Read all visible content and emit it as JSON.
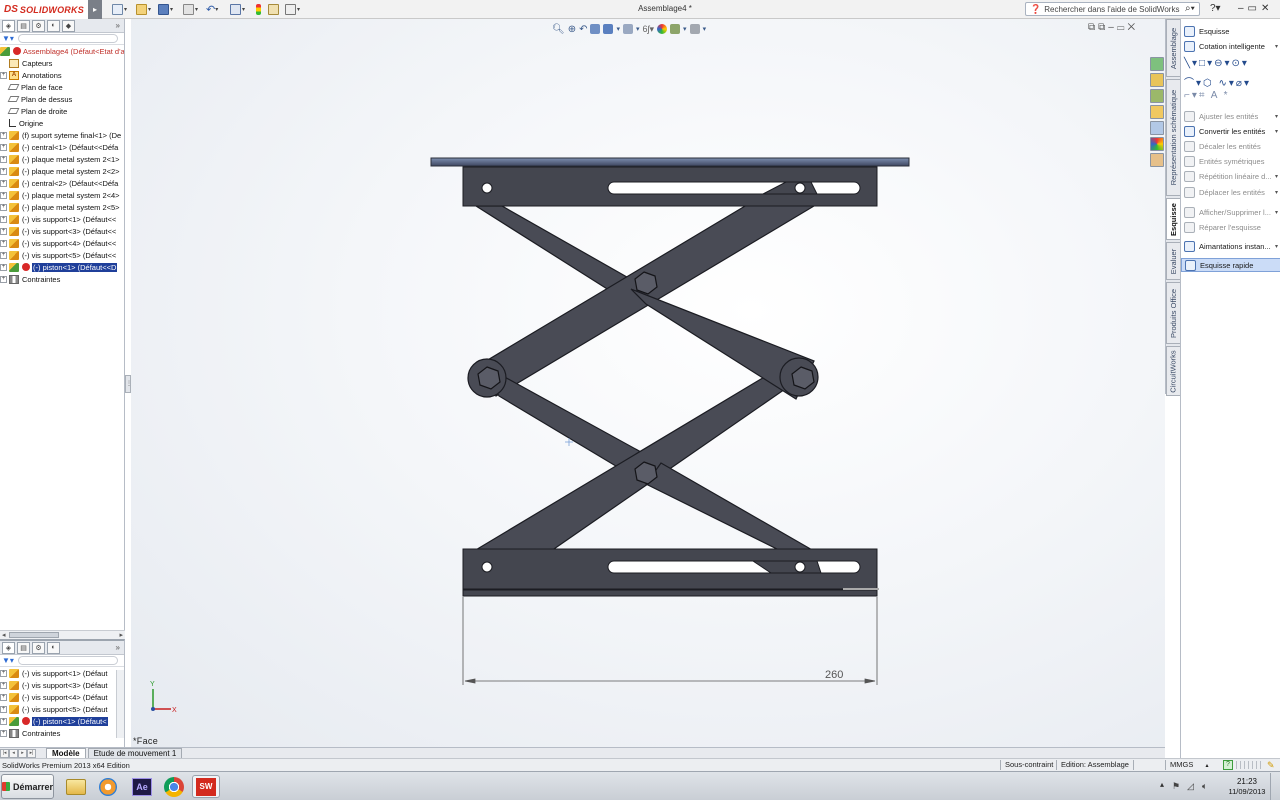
{
  "app": {
    "logo_ds": "DS",
    "logo_text": "SOLIDWORKS",
    "document_title": "Assemblage4 *",
    "search_placeholder": "Rechercher dans l'aide de SolidWorks"
  },
  "feature_tree": {
    "root": "Assemblage4  (Défaut<Etat d'a",
    "items": [
      {
        "label": "Capteurs",
        "icon": "sensor-icon",
        "expandable": false
      },
      {
        "label": "Annotations",
        "icon": "annotations-icon",
        "expandable": true
      },
      {
        "label": "Plan de face",
        "icon": "plane-icon",
        "expandable": false
      },
      {
        "label": "Plan de dessus",
        "icon": "plane-icon",
        "expandable": false
      },
      {
        "label": "Plan de droite",
        "icon": "plane-icon",
        "expandable": false
      },
      {
        "label": "Origine",
        "icon": "origin-icon",
        "expandable": false
      },
      {
        "label": "(f) suport syteme final<1> (De",
        "icon": "part-icon",
        "expandable": true
      },
      {
        "label": "(-) central<1> (Défaut<<Défa",
        "icon": "part-icon",
        "expandable": true
      },
      {
        "label": "(-) plaque metal system 2<1>",
        "icon": "part-icon",
        "expandable": true
      },
      {
        "label": "(-) plaque metal system 2<2>",
        "icon": "part-icon",
        "expandable": true
      },
      {
        "label": "(-) central<2> (Défaut<<Défa",
        "icon": "part-icon",
        "expandable": true
      },
      {
        "label": "(-) plaque metal system 2<4>",
        "icon": "part-icon",
        "expandable": true
      },
      {
        "label": "(-) plaque metal system 2<5>",
        "icon": "part-icon",
        "expandable": true
      },
      {
        "label": "(-) vis support<1> (Défaut<<",
        "icon": "part-icon",
        "expandable": true
      },
      {
        "label": "(-) vis support<3> (Défaut<<",
        "icon": "part-icon",
        "expandable": true
      },
      {
        "label": "(-) vis support<4> (Défaut<<",
        "icon": "part-icon",
        "expandable": true
      },
      {
        "label": "(-) vis support<5> (Défaut<<",
        "icon": "part-icon",
        "expandable": true
      },
      {
        "label": "(-) piston<1> (Défaut<<D",
        "icon": "assembly-icon",
        "expandable": true,
        "error": true,
        "selected": true
      },
      {
        "label": "Contraintes",
        "icon": "mates-icon",
        "expandable": true
      }
    ]
  },
  "secondary_tree": {
    "items": [
      {
        "label": "(-) vis support<1> (Défaut",
        "error": false,
        "selected": false
      },
      {
        "label": "(-) vis support<3> (Défaut",
        "error": false,
        "selected": false
      },
      {
        "label": "(-) vis support<4> (Défaut",
        "error": false,
        "selected": false
      },
      {
        "label": "(-) vis support<5> (Défaut",
        "error": false,
        "selected": false
      },
      {
        "label": "(-) piston<1> (Défaut<",
        "error": true,
        "selected": true
      },
      {
        "label": "Contraintes",
        "error": false,
        "selected": false
      }
    ]
  },
  "model_tabs": [
    "Modèle",
    "Etude de mouvement 1"
  ],
  "graphics": {
    "view_label": "*Face",
    "dimension_value": "260",
    "triad_x": "X",
    "triad_y": "Y"
  },
  "task_tabs": [
    "Assemblage",
    "Représentation schématique",
    "Esquisse",
    "Evaluer",
    "Produits Office",
    "CircuitWorks"
  ],
  "active_task_tab": "Esquisse",
  "command_manager": {
    "items": [
      {
        "label": "Esquisse",
        "enabled": true,
        "dropdown": false
      },
      {
        "label": "Cotation intelligente",
        "enabled": true,
        "dropdown": true
      },
      {
        "label": "Ajuster les entités",
        "enabled": false,
        "dropdown": true
      },
      {
        "label": "Convertir les entités",
        "enabled": true,
        "dropdown": true
      },
      {
        "label": "Décaler les entités",
        "enabled": false,
        "dropdown": false
      },
      {
        "label": "Entités symétriques",
        "enabled": false,
        "dropdown": false
      },
      {
        "label": "Répétition linéaire d...",
        "enabled": false,
        "dropdown": true
      },
      {
        "label": "Déplacer les entités",
        "enabled": false,
        "dropdown": true
      },
      {
        "label": "Afficher/Supprimer l...",
        "enabled": false,
        "dropdown": true
      },
      {
        "label": "Réparer l'esquisse",
        "enabled": false,
        "dropdown": false
      },
      {
        "label": "Aimantations instan...",
        "enabled": true,
        "dropdown": true
      },
      {
        "label": "Esquisse rapide",
        "enabled": true,
        "dropdown": false,
        "highlighted": true
      }
    ]
  },
  "status_bar": {
    "edition": "SolidWorks Premium 2013 x64 Edition",
    "constraint": "Sous-contraint",
    "editing": "Edition: Assemblage",
    "units": "MMGS"
  },
  "taskbar": {
    "start_label": "Démarrer",
    "time": "21:23",
    "date": "11/09/2013",
    "apps": [
      "explorer-icon",
      "media-player-icon",
      "after-effects-icon",
      "chrome-icon",
      "solidworks-icon"
    ]
  },
  "colors": {
    "accent_red": "#d32a1e",
    "metal": "#44464f",
    "selection": "#1f3f9a",
    "highlight": "#cbdcf7"
  }
}
